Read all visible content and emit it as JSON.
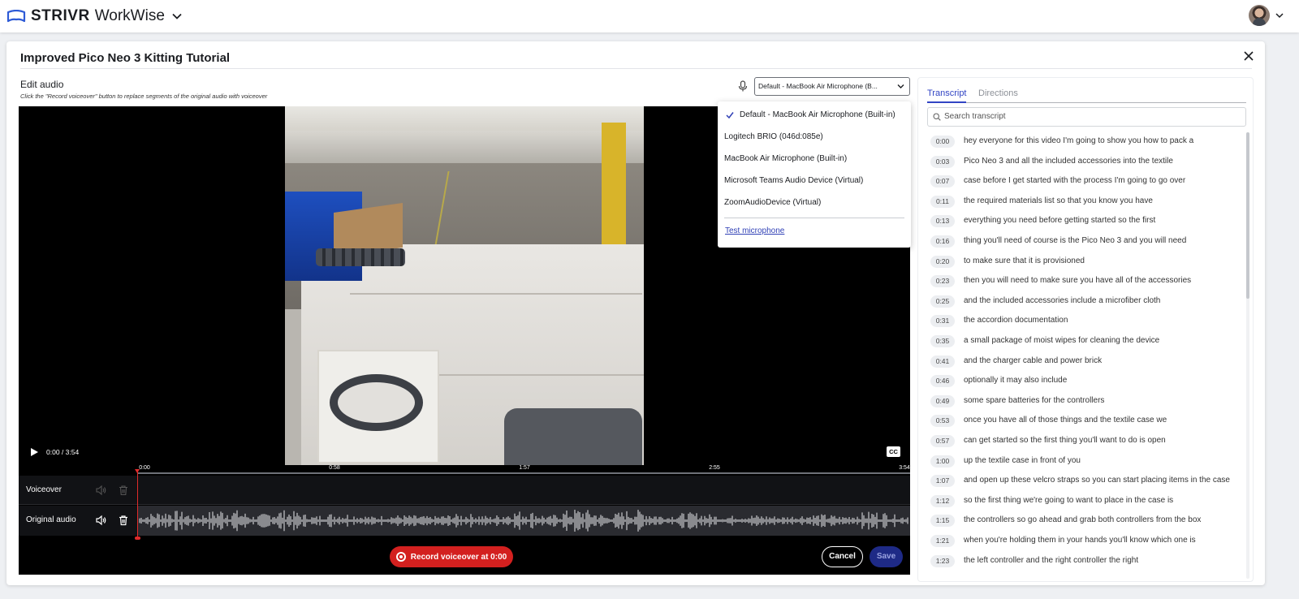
{
  "app": {
    "brand_name": "STRIVR",
    "product_name": "WorkWise"
  },
  "modal": {
    "title": "Improved Pico Neo 3 Kitting Tutorial",
    "edit_label": "Edit audio",
    "edit_hint": "Click the \"Record voiceover\" button to replace segments of the original audio with voiceover",
    "mic_selected": "Default - MacBook Air Microphone (B..."
  },
  "dropdown": {
    "items": [
      "Default - MacBook Air Microphone (Built-in)",
      "Logitech BRIO (046d:085e)",
      "MacBook Air Microphone (Built-in)",
      "Microsoft Teams Audio Device (Virtual)",
      "ZoomAudioDevice (Virtual)"
    ],
    "checked_index": 0,
    "test_label": "Test microphone"
  },
  "video": {
    "time": "0:00 / 3:54",
    "cc_label": "CC"
  },
  "timeline": {
    "ticks": [
      "0:00",
      "0:58",
      "1:57",
      "2:55",
      "3:54"
    ],
    "voiceover_label": "Voiceover",
    "original_label": "Original audio"
  },
  "actions": {
    "record_label": "Record voiceover at 0:00",
    "cancel_label": "Cancel",
    "save_label": "Save"
  },
  "transcript": {
    "tab_transcript": "Transcript",
    "tab_directions": "Directions",
    "search_placeholder": "Search transcript",
    "rows": [
      {
        "time": "0:00",
        "text": "hey everyone for this video I'm going to show you how to pack a"
      },
      {
        "time": "0:03",
        "text": "Pico Neo 3 and all the included accessories into the textile"
      },
      {
        "time": "0:07",
        "text": "case before I get started with the process I'm going to go over"
      },
      {
        "time": "0:11",
        "text": "the required materials list so that you know you have"
      },
      {
        "time": "0:13",
        "text": "everything you need before getting started so the first"
      },
      {
        "time": "0:16",
        "text": "thing you'll need of course is the Pico Neo 3 and you will need"
      },
      {
        "time": "0:20",
        "text": "to make sure that it is provisioned"
      },
      {
        "time": "0:23",
        "text": "then you will need to make sure you have all of the accessories"
      },
      {
        "time": "0:25",
        "text": "and the included accessories include a microfiber cloth"
      },
      {
        "time": "0:31",
        "text": "the accordion documentation"
      },
      {
        "time": "0:35",
        "text": "a small package of moist wipes for cleaning the device"
      },
      {
        "time": "0:41",
        "text": "and the charger cable and power brick"
      },
      {
        "time": "0:46",
        "text": "optionally it may also include"
      },
      {
        "time": "0:49",
        "text": "some spare batteries for the controllers"
      },
      {
        "time": "0:53",
        "text": "once you have all of those things and the textile case we"
      },
      {
        "time": "0:57",
        "text": "can get started so the first thing you'll want to do is open"
      },
      {
        "time": "1:00",
        "text": "up the textile case in front of you"
      },
      {
        "time": "1:07",
        "text": "and open up these velcro straps so you can start placing items in the case"
      },
      {
        "time": "1:12",
        "text": "so the first thing we're going to want to place in the case is"
      },
      {
        "time": "1:15",
        "text": "the controllers so go ahead and grab both controllers from the box"
      },
      {
        "time": "1:21",
        "text": "when you're holding them in your hands you'll know which one is"
      },
      {
        "time": "1:23",
        "text": "the left controller and the right controller the right"
      }
    ]
  },
  "colors": {
    "accent": "#3245c4",
    "record": "#d3201f",
    "save": "#1e2a86"
  }
}
